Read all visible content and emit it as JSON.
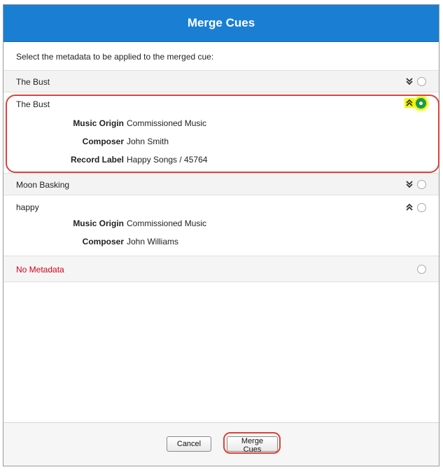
{
  "dialog": {
    "title": "Merge Cues",
    "instruction": "Select the metadata to be applied to the merged cue:"
  },
  "cues": [
    {
      "title": "The Bust",
      "expanded": false,
      "chevron": "double-chevron-down-icon",
      "selected": false,
      "metadata": []
    },
    {
      "title": "The Bust",
      "expanded": true,
      "chevron": "double-chevron-up-icon",
      "selected": true,
      "metadata": [
        {
          "label": "Music Origin",
          "value": "Commissioned Music"
        },
        {
          "label": "Composer",
          "value": "John Smith"
        },
        {
          "label": "Record Label",
          "value": "Happy Songs / 45764"
        }
      ]
    },
    {
      "title": "Moon Basking",
      "expanded": false,
      "chevron": "double-chevron-down-icon",
      "selected": false,
      "metadata": []
    },
    {
      "title": "happy",
      "expanded": true,
      "chevron": "double-chevron-up-icon",
      "selected": false,
      "metadata": [
        {
          "label": "Music Origin",
          "value": "Commissioned Music"
        },
        {
          "label": "Composer",
          "value": "John Williams"
        }
      ]
    }
  ],
  "no_metadata": {
    "label": "No Metadata",
    "selected": false
  },
  "footer": {
    "cancel_label": "Cancel",
    "merge_label": "Merge Cues"
  },
  "colors": {
    "title_bar": "#1a7fd3",
    "no_metadata_text": "#d0021b",
    "selected_radio": "#1a9a4a",
    "highlight": "#f4f800",
    "annotation_outline": "#d9443b"
  }
}
